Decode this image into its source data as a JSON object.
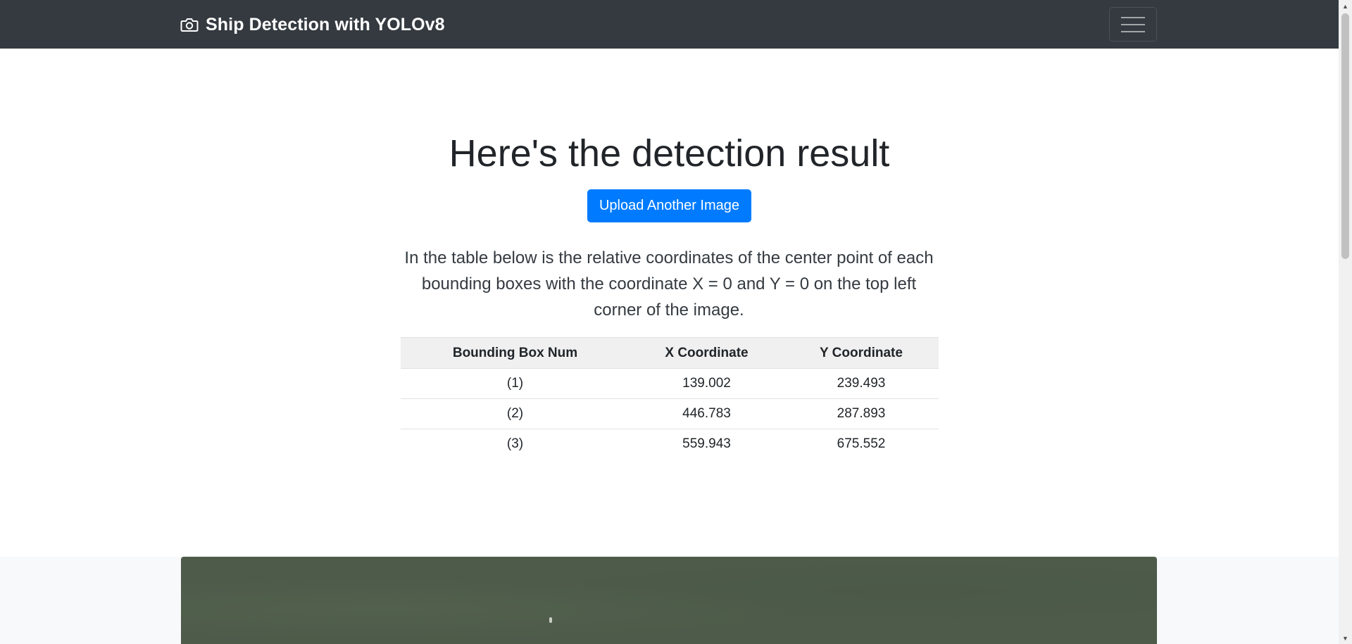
{
  "navbar": {
    "brand_label": "Ship Detection with YOLOv8",
    "brand_icon": "camera-icon",
    "toggler_icon": "hamburger-menu-icon"
  },
  "main": {
    "heading": "Here's the detection result",
    "upload_button_label": "Upload Another Image",
    "description": "In the table below is the relative coordinates of the center point of each bounding boxes with the coordinate X = 0 and Y = 0 on the top left corner of the image."
  },
  "table": {
    "headers": [
      "Bounding Box Num",
      "X Coordinate",
      "Y Coordinate"
    ],
    "rows": [
      [
        "(1)",
        "139.002",
        "239.493"
      ],
      [
        "(2)",
        "446.783",
        "287.893"
      ],
      [
        "(3)",
        "559.943",
        "675.552"
      ]
    ]
  },
  "colors": {
    "navbar_bg": "#343a40",
    "primary": "#007bff",
    "table_header_bg": "#f0f0f0",
    "image_section_bg": "#f8f9fa"
  }
}
